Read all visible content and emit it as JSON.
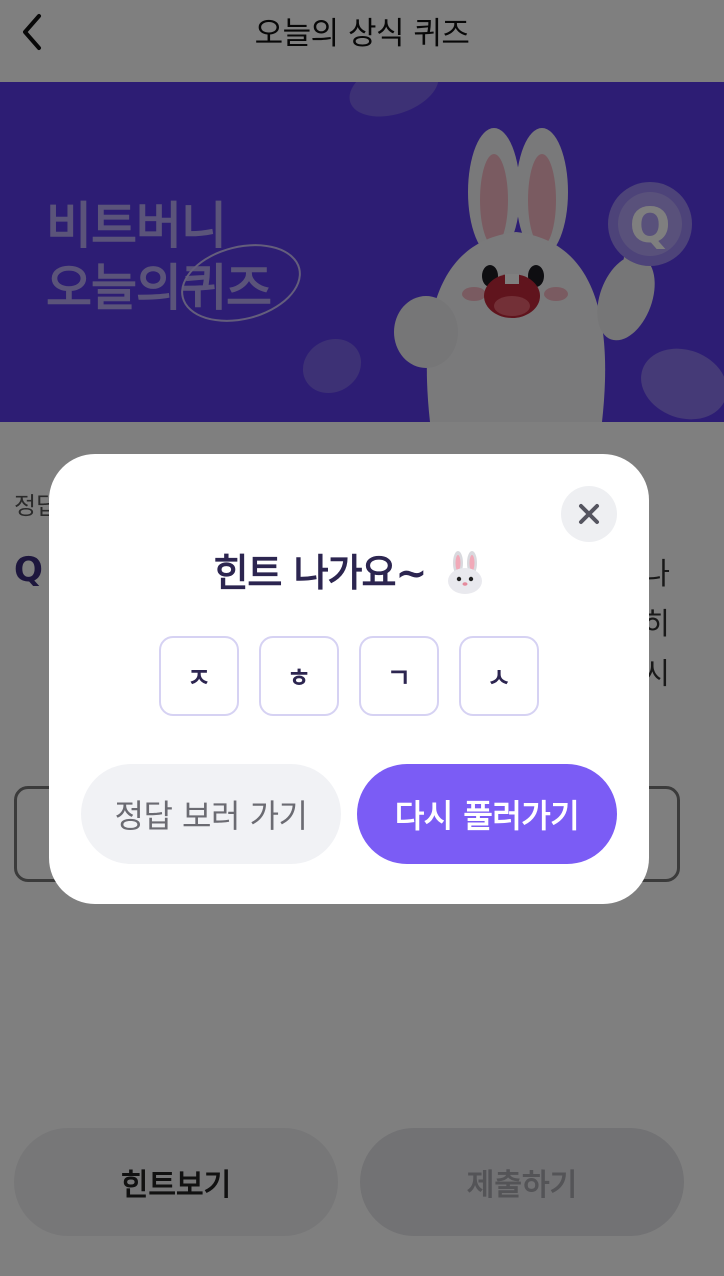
{
  "header": {
    "title": "오늘의 상식 퀴즈"
  },
  "banner": {
    "line1": "비트버니",
    "line2_prefix": "오늘의",
    "line2_circled": "퀴즈",
    "sign_letter": "Q"
  },
  "background": {
    "label": "정답",
    "question_prefix": "Q",
    "question_text_fragments": [
      "나",
      "히",
      "시"
    ],
    "hint_button": "힌트보기",
    "submit_button": "제출하기"
  },
  "modal": {
    "title": "힌트 나가요~",
    "hints": [
      "ㅈ",
      "ㅎ",
      "ㄱ",
      "ㅅ"
    ],
    "view_answer_button": "정답 보러 가기",
    "retry_button": "다시 풀러가기"
  },
  "colors": {
    "banner_bg": "#5a3be8",
    "accent": "#7b5cf5",
    "title_text": "#2c2550",
    "overlay": "rgba(0,0,0,0.5)"
  },
  "icons": {
    "back": "chevron-left-icon",
    "close": "close-icon",
    "bunny": "rabbit-face-icon"
  }
}
